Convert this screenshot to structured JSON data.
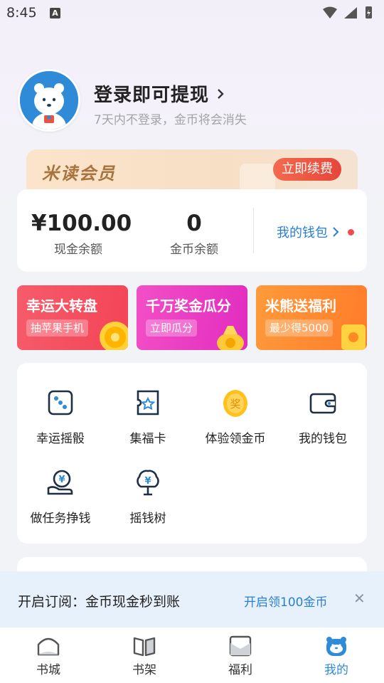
{
  "status_bar": {
    "time": "8:45",
    "notification_icon": "A"
  },
  "profile": {
    "login_title": "登录即可提现",
    "login_hint": "7天内不登录，金币将会消失"
  },
  "vip_banner": {
    "title": "米读会员",
    "button_label": "立即续费"
  },
  "wallet": {
    "cash_value": "¥100.00",
    "cash_label": "现金余额",
    "coin_value": "0",
    "coin_label": "金币余额",
    "wallet_link": "我的钱包"
  },
  "promos": [
    {
      "title": "幸运大转盘",
      "tag": "抽苹果手机"
    },
    {
      "title": "千万奖金瓜分",
      "tag": "立即瓜分"
    },
    {
      "title": "米熊送福利",
      "tag": "最少得5000"
    }
  ],
  "features": [
    {
      "label": "幸运摇骰",
      "icon": "dice-icon"
    },
    {
      "label": "集福卡",
      "icon": "fortune-card-icon"
    },
    {
      "label": "体验领金币",
      "icon": "gold-egg-icon",
      "icon_text": "奖"
    },
    {
      "label": "我的钱包",
      "icon": "wallet-icon"
    },
    {
      "label": "做任务挣钱",
      "icon": "task-money-icon"
    },
    {
      "label": "摇钱树",
      "icon": "money-tree-icon"
    }
  ],
  "subscribe_bar": {
    "text": "开启订阅：金币现金秒到账",
    "link": "开启领100金币",
    "close": "✕"
  },
  "tabs": [
    {
      "label": "书城",
      "icon": "bookstore-icon",
      "active": false
    },
    {
      "label": "书架",
      "icon": "bookshelf-icon",
      "active": false
    },
    {
      "label": "福利",
      "icon": "welfare-icon",
      "active": false
    },
    {
      "label": "我的",
      "icon": "profile-bear-icon",
      "active": true
    }
  ],
  "colors": {
    "accent_blue": "#2f8bd8",
    "link_blue": "#2a7fd4",
    "vip_gold": "#a7743f",
    "vip_button": "#e6453a",
    "promo_red": "#f34457",
    "promo_pink": "#e12cc0",
    "promo_orange": "#ff7c2a"
  }
}
